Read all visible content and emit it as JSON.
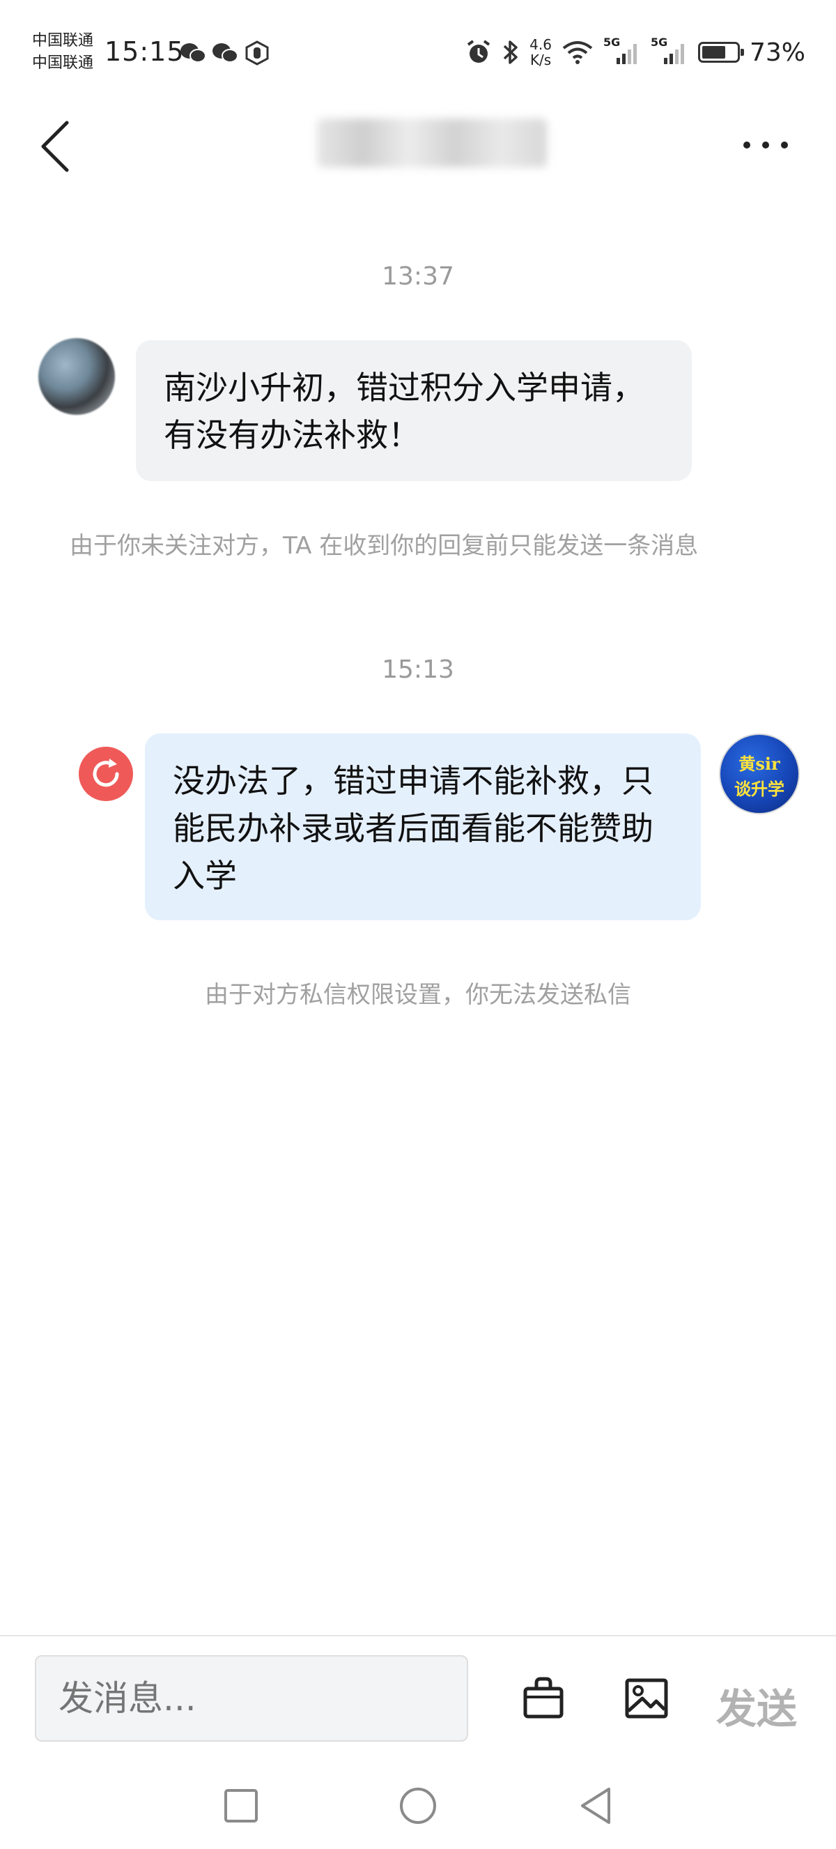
{
  "status_bar": {
    "carrier_1": "中国联通",
    "carrier_2": "中国联通",
    "time": "15:15",
    "net_speed_value": "4.6",
    "net_speed_unit": "K/s",
    "signal_1_label": "5G",
    "signal_2_label": "5G",
    "battery": "73%",
    "battery_level": 0.73
  },
  "header": {
    "back_icon": "chevron-left-icon",
    "more_icon": "more-horizontal-icon"
  },
  "messages": [
    {
      "time": "13:37",
      "sender": "other",
      "text": "南沙小升初，错过积分入学申请，有没有办法补救！",
      "notice": "由于你未关注对方，TA 在收到你的回复前只能发送一条消息"
    },
    {
      "time": "15:13",
      "sender": "self",
      "text": "没办法了，错过申请不能补救，只能民办补录或者后面看能不能赞助入学",
      "failed_icon": "retry-icon",
      "avatar_text_1": "黄sir",
      "avatar_text_2": "谈升学",
      "notice": "由于对方私信权限设置，你无法发送私信"
    }
  ],
  "input_bar": {
    "placeholder": "发消息...",
    "shop_icon": "shopping-bag-icon",
    "image_icon": "image-icon",
    "send_label": "发送"
  },
  "nav_bar": {
    "recent_icon": "square-icon",
    "home_icon": "circle-icon",
    "back_icon": "triangle-back-icon"
  }
}
